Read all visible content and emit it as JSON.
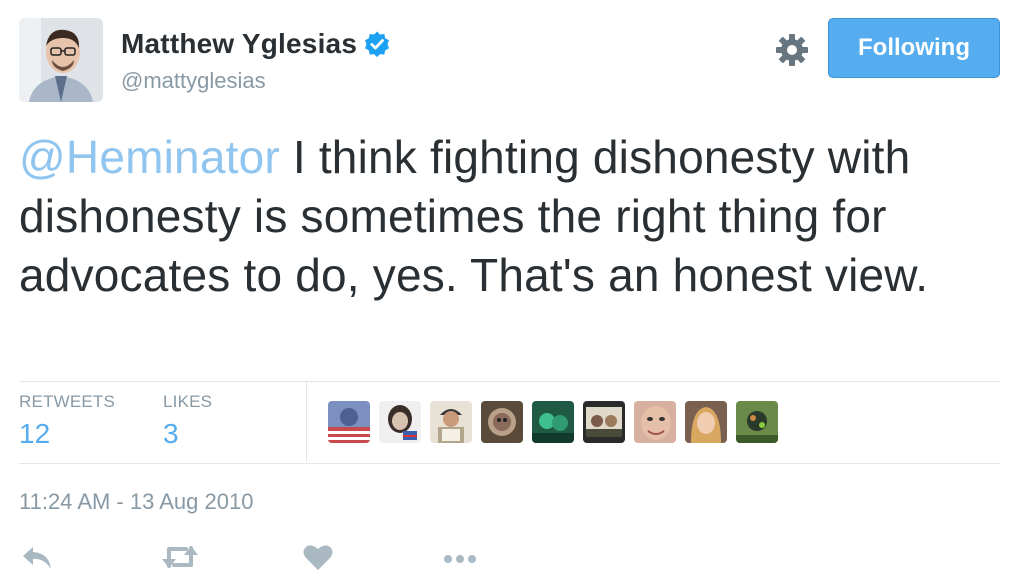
{
  "author": {
    "display_name": "Matthew Yglesias",
    "handle": "@mattyglesias",
    "verified": true
  },
  "follow_button": {
    "label": "Following"
  },
  "tweet": {
    "mention": "@Heminator",
    "text": " I think fighting dishonesty with dishonesty is sometimes the right thing for advocates to do, yes. That's an honest view."
  },
  "stats": {
    "retweets_label": "RETWEETS",
    "retweets_count": "12",
    "likes_label": "LIKES",
    "likes_count": "3"
  },
  "likers": [
    {
      "name": "liker-avatar-1",
      "color": "#5a6fa8"
    },
    {
      "name": "liker-avatar-2",
      "color": "#3a2e2a"
    },
    {
      "name": "liker-avatar-3",
      "color": "#c9b9a0"
    },
    {
      "name": "liker-avatar-4",
      "color": "#8a7a6a"
    },
    {
      "name": "liker-avatar-5",
      "color": "#2f8a6a"
    },
    {
      "name": "liker-avatar-6",
      "color": "#6a6a5a"
    },
    {
      "name": "liker-avatar-7",
      "color": "#c98a7a"
    },
    {
      "name": "liker-avatar-8",
      "color": "#c9a080"
    },
    {
      "name": "liker-avatar-9",
      "color": "#4a6a3a"
    }
  ],
  "timestamp": "11:24 AM - 13 Aug 2010",
  "actions": [
    "reply-icon",
    "retweet-icon",
    "like-icon",
    "more-icon"
  ],
  "colors": {
    "accent": "#55acee",
    "mention": "#90c5f0",
    "muted": "#8899a6",
    "text": "#292f33"
  }
}
